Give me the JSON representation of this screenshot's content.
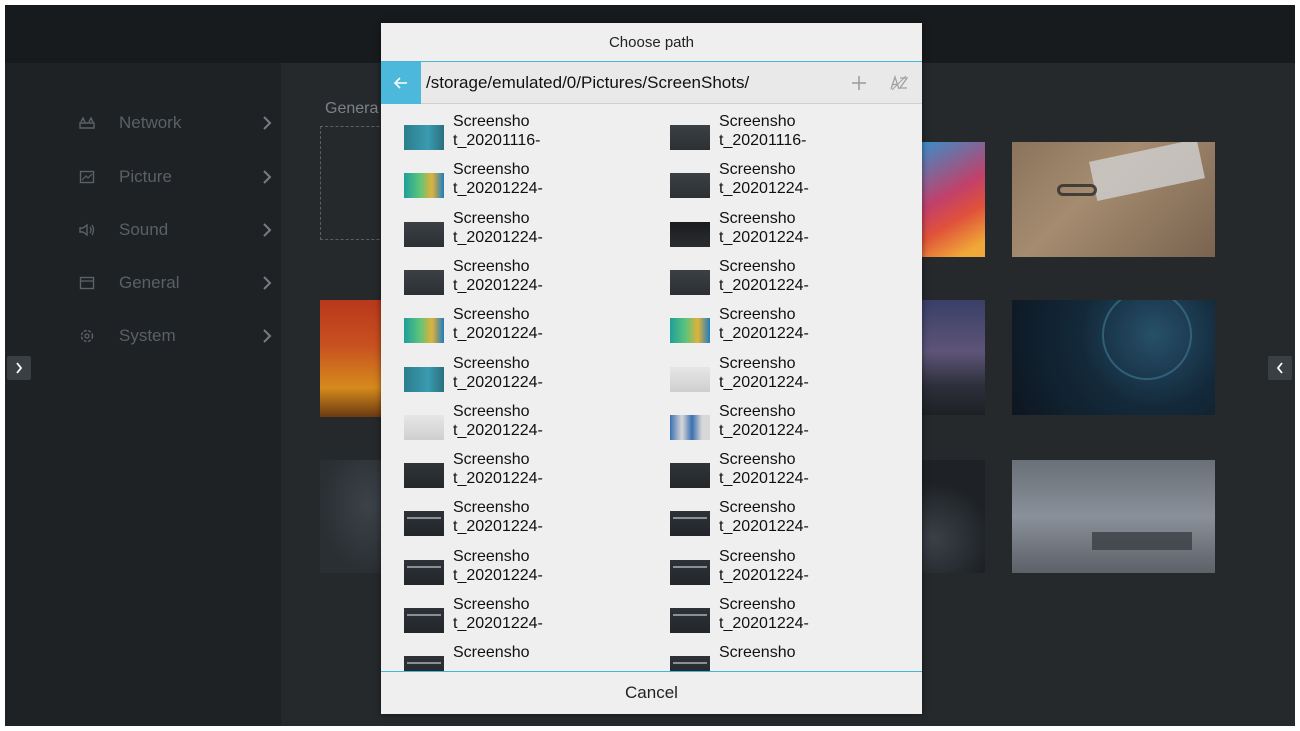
{
  "sidebar": {
    "items": [
      {
        "label": "Network",
        "icon": "network-icon"
      },
      {
        "label": "Picture",
        "icon": "picture-icon"
      },
      {
        "label": "Sound",
        "icon": "sound-icon"
      },
      {
        "label": "General",
        "icon": "general-icon"
      },
      {
        "label": "System",
        "icon": "system-icon"
      }
    ]
  },
  "main": {
    "section_label": "Genera"
  },
  "dialog": {
    "title": "Choose path",
    "path": "/storage/emulated/0/Pictures/ScreenShots/",
    "cancel_label": "Cancel",
    "files": [
      {
        "name": "Screensho\nt_20201116-",
        "thumb": "teal"
      },
      {
        "name": "Screensho\nt_20201116-",
        "thumb": "darkui"
      },
      {
        "name": "Screensho\nt_20201224-",
        "thumb": "gradient"
      },
      {
        "name": "Screensho\nt_20201224-",
        "thumb": "darkui"
      },
      {
        "name": "Screensho\nt_20201224-",
        "thumb": "darkui"
      },
      {
        "name": "Screensho\nt_20201224-",
        "thumb": "black"
      },
      {
        "name": "Screensho\nt_20201224-",
        "thumb": "darkui"
      },
      {
        "name": "Screensho\nt_20201224-",
        "thumb": "darkui"
      },
      {
        "name": "Screensho\nt_20201224-",
        "thumb": "gradient"
      },
      {
        "name": "Screensho\nt_20201224-",
        "thumb": "gradient"
      },
      {
        "name": "Screensho\nt_20201224-",
        "thumb": "teal"
      },
      {
        "name": "Screensho\nt_20201224-",
        "thumb": "lightui"
      },
      {
        "name": "Screensho\nt_20201224-",
        "thumb": "lightui"
      },
      {
        "name": "Screensho\nt_20201224-",
        "thumb": "colorgrid"
      },
      {
        "name": "Screensho\nt_20201224-",
        "thumb": "dark"
      },
      {
        "name": "Screensho\nt_20201224-",
        "thumb": "dark"
      },
      {
        "name": "Screensho\nt_20201224-",
        "thumb": "darkbar"
      },
      {
        "name": "Screensho\nt_20201224-",
        "thumb": "darkbar"
      },
      {
        "name": "Screensho\nt_20201224-",
        "thumb": "darkbar"
      },
      {
        "name": "Screensho\nt_20201224-",
        "thumb": "darkbar"
      },
      {
        "name": "Screensho\nt_20201224-",
        "thumb": "darkbar"
      },
      {
        "name": "Screensho\nt_20201224-",
        "thumb": "darkbar"
      },
      {
        "name": "Screensho",
        "thumb": "darkbar"
      },
      {
        "name": "Screensho",
        "thumb": "darkbar"
      }
    ]
  },
  "colors": {
    "accent": "#4cb8dc",
    "divider": "#45b5d4",
    "background": "#25292c",
    "dialog_bg": "#efefef"
  }
}
